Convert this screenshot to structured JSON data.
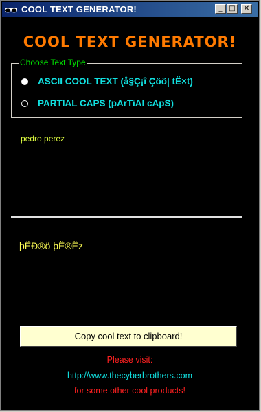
{
  "window": {
    "title": "COOL TEXT GENERATOR!",
    "icon": "sunglasses-icon",
    "buttons": {
      "minimize": "_",
      "maximize": "□",
      "close": "✕"
    }
  },
  "app": {
    "heading": "COOL TEXT GENERATOR!"
  },
  "text_type": {
    "legend": "Choose Text Type",
    "options": [
      {
        "label": "ASCII COOL TEXT (å§Ç¡î Çöö| tË×t)",
        "selected": true
      },
      {
        "label": "PARTIAL CAPS (pArTiAl cApS)",
        "selected": false
      }
    ]
  },
  "input": {
    "value": "pedro perez"
  },
  "output": {
    "value": "þËÐ®ö þË®Ëz"
  },
  "copy_button": {
    "label": "Copy cool text to clipboard!"
  },
  "footer": {
    "line1": "Please visit:",
    "line2": "http://www.thecyberbrothers.com",
    "line3": "for some other cool products!"
  },
  "colors": {
    "heading": "#ff7a00",
    "legend": "#00dd00",
    "radio_label": "#11e0e0",
    "output": "#ffff55",
    "footer_red": "#ff2020",
    "titlebar_start": "#0a246a",
    "titlebar_end": "#3a6ea5"
  }
}
